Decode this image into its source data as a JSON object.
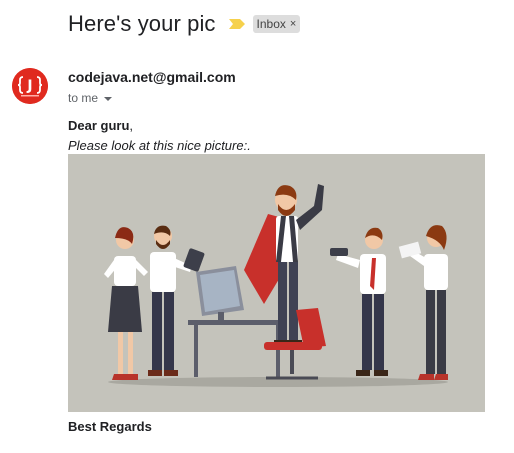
{
  "email": {
    "subject": "Here's your pic",
    "label_chip": "Inbox",
    "label_remove_glyph": "×",
    "important_marker_color": "#f6d14c",
    "avatar_letter": "J",
    "avatar_color": "#e02a1f",
    "sender": "codejava.net@gmail.com",
    "to_line": "to me",
    "greeting_name": "Dear guru",
    "greeting_punct": ",",
    "body_line": "Please look at this nice picture:.",
    "signature": "Best Regards",
    "picture_bg": "#c4c3bb"
  }
}
